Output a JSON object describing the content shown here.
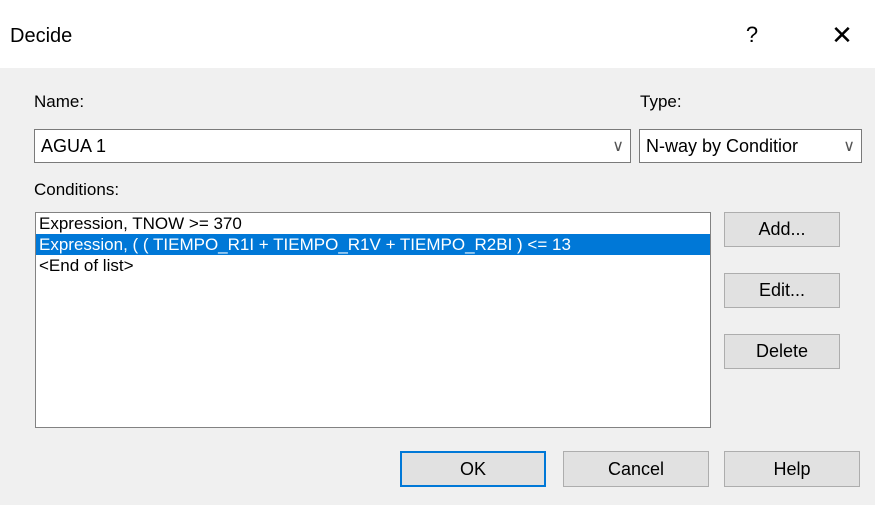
{
  "window": {
    "title": "Decide",
    "help_glyph": "?",
    "close_glyph": "✕"
  },
  "name": {
    "label": "Name:",
    "value": "AGUA 1"
  },
  "type": {
    "label": "Type:",
    "value": "N-way by Conditior"
  },
  "conditions": {
    "label": "Conditions:",
    "items": [
      "Expression, TNOW >= 370",
      "Expression, ( ( TIEMPO_R1I + TIEMPO_R1V + TIEMPO_R2BI ) <= 13",
      "<End of list>"
    ],
    "selected_index": 1
  },
  "side_buttons": {
    "add": "Add...",
    "edit": "Edit...",
    "delete": "Delete"
  },
  "footer_buttons": {
    "ok": "OK",
    "cancel": "Cancel",
    "help": "Help"
  },
  "colors": {
    "selection": "#0078d7",
    "client_bg": "#f0f0f0"
  }
}
